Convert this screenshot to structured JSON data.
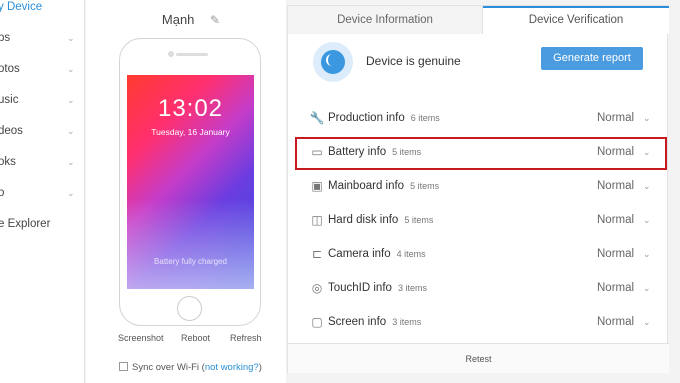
{
  "sidebar": {
    "items": [
      {
        "label": "y Device",
        "active": true,
        "chevron": false
      },
      {
        "label": "ps",
        "chevron": true
      },
      {
        "label": "otos",
        "chevron": true
      },
      {
        "label": "usic",
        "chevron": true
      },
      {
        "label": "deos",
        "chevron": true
      },
      {
        "label": "oks",
        "chevron": true
      },
      {
        "label": "o",
        "chevron": true
      },
      {
        "label": "e Explorer",
        "chevron": false
      }
    ]
  },
  "device": {
    "name": "Mạnh",
    "time": "13:02",
    "date": "Tuesday, 16 January",
    "charge_text": "Battery fully charged",
    "actions": {
      "screenshot": "Screenshot",
      "reboot": "Reboot",
      "refresh": "Refresh"
    },
    "sync": {
      "label": "Sync over Wi-Fi (",
      "link": "not working?",
      "close": ")"
    }
  },
  "tabs": {
    "info": "Device Information",
    "verification": "Device Verification"
  },
  "verification": {
    "status_text": "Device is  genuine",
    "report_button": "Generate report",
    "rows": [
      {
        "icon": "wrench-icon",
        "glyph": "🔧",
        "name": "Production info",
        "count": "6 items",
        "status": "Normal"
      },
      {
        "icon": "battery-icon",
        "glyph": "▭",
        "name": "Battery info",
        "count": "5 items",
        "status": "Normal"
      },
      {
        "icon": "mainboard-icon",
        "glyph": "▣",
        "name": "Mainboard info",
        "count": "5 items",
        "status": "Normal"
      },
      {
        "icon": "hard-disk-icon",
        "glyph": "◫",
        "name": "Hard disk info",
        "count": "5 items",
        "status": "Normal"
      },
      {
        "icon": "camera-icon",
        "glyph": "⊏",
        "name": "Camera info",
        "count": "4 items",
        "status": "Normal"
      },
      {
        "icon": "touchid-icon",
        "glyph": "◎",
        "name": "TouchID info",
        "count": "3 items",
        "status": "Normal"
      },
      {
        "icon": "screen-icon",
        "glyph": "▢",
        "name": "Screen info",
        "count": "3 items",
        "status": "Normal"
      }
    ],
    "retest": "Retest"
  },
  "colors": {
    "accent": "#2a8fd8",
    "highlight": "#c8191f",
    "button": "#4a9be0"
  }
}
